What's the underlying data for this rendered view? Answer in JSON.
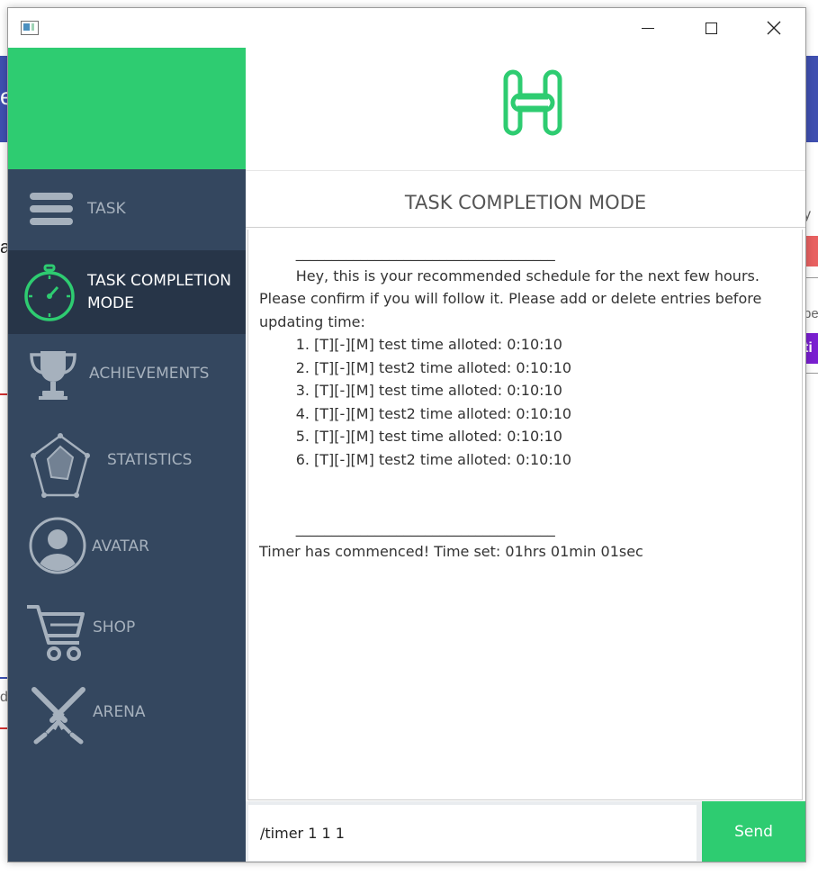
{
  "background": {
    "left_letter_1": "e",
    "left_letter_2": "a",
    "left_letter_3": "d",
    "right_text_1": "y",
    "right_text_2": "pe",
    "right_text_3": "ti"
  },
  "sidebar": {
    "items": [
      {
        "label": "TASK",
        "icon": "menu-icon"
      },
      {
        "label": "TASK COMPLETION MODE",
        "icon": "stopwatch-icon",
        "active": true
      },
      {
        "label": "ACHIEVEMENTS",
        "icon": "trophy-icon"
      },
      {
        "label": "STATISTICS",
        "icon": "radar-chart-icon"
      },
      {
        "label": "AVATAR",
        "icon": "user-avatar-icon"
      },
      {
        "label": "SHOP",
        "icon": "shopping-cart-icon"
      },
      {
        "label": "ARENA",
        "icon": "crossed-swords-icon"
      }
    ]
  },
  "main": {
    "logo": "H-logo-icon",
    "title": "TASK COMPLETION MODE",
    "output": "        ____________________________________\n        Hey, this is your recommended schedule for the next few hours. Please confirm if you will follow it. Please add or delete entries before updating time:\n        1. [T][-][M] test time alloted: 0:10:10\n        2. [T][-][M] test2 time alloted: 0:10:10\n        3. [T][-][M] test time alloted: 0:10:10\n        4. [T][-][M] test2 time alloted: 0:10:10\n        5. [T][-][M] test time alloted: 0:10:10\n        6. [T][-][M] test2 time alloted: 0:10:10\n\n\n        ____________________________________\nTimer has commenced! Time set: 01hrs 01min 01sec",
    "input_value": "/timer 1 1 1",
    "send_label": "Send"
  },
  "colors": {
    "accent_green": "#2ecc71",
    "sidebar_bg": "#34475f",
    "sidebar_active": "#273548",
    "icon_gray": "#a6b1bd"
  }
}
